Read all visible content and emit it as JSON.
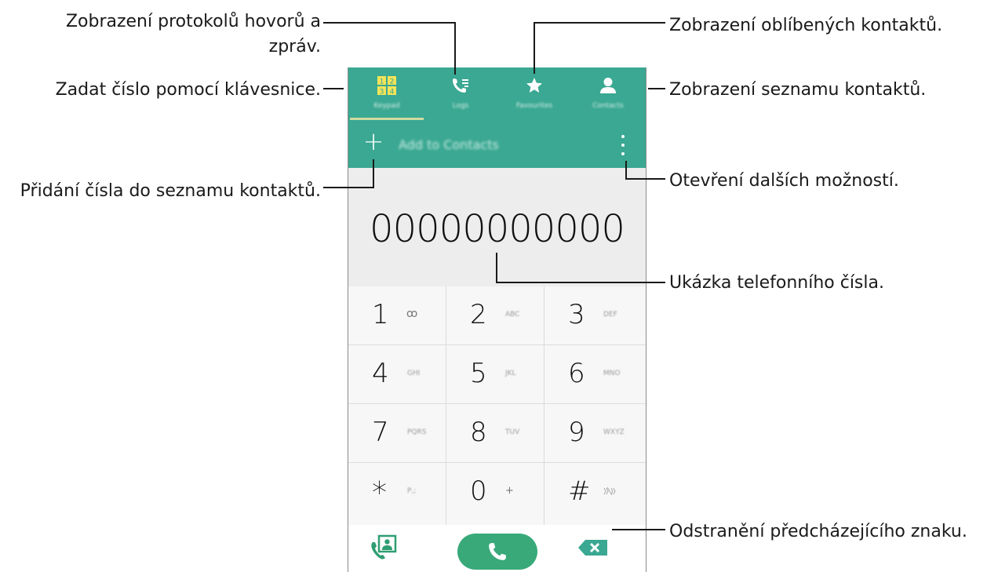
{
  "annotations": {
    "logs": [
      "Zobrazení protokolů hovorů a",
      "zpráv."
    ],
    "keypad": "Zadat číslo pomocí klávesnice.",
    "add_contact": "Přidání čísla do seznamu kontaktů.",
    "favourites": "Zobrazení oblíbených kontaktů.",
    "contacts": "Zobrazení seznamu kontaktů.",
    "more_options": "Otevření dalších možností.",
    "number_preview": "Ukázka telefonního čísla.",
    "delete_char": "Odstranění předcházejícího znaku."
  },
  "phone": {
    "tabs": [
      {
        "label": "Keypad",
        "icon": "keypad-icon"
      },
      {
        "label": "Logs",
        "icon": "call-log-icon"
      },
      {
        "label": "Favourites",
        "icon": "star-icon"
      },
      {
        "label": "Contacts",
        "icon": "person-icon"
      }
    ],
    "action_bar": {
      "plus": "+",
      "add_label": "Add to Contacts",
      "more_icon": "more-vertical-icon"
    },
    "number": "00000000000",
    "keys": [
      {
        "digit": "1",
        "letters": "ꝏ"
      },
      {
        "digit": "2",
        "letters": "ABC"
      },
      {
        "digit": "3",
        "letters": "DEF"
      },
      {
        "digit": "4",
        "letters": "GHI"
      },
      {
        "digit": "5",
        "letters": "JKL"
      },
      {
        "digit": "6",
        "letters": "MNO"
      },
      {
        "digit": "7",
        "letters": "PQRS"
      },
      {
        "digit": "8",
        "letters": "TUV"
      },
      {
        "digit": "9",
        "letters": "WXYZ"
      },
      {
        "digit": "*",
        "letters": "P,;"
      },
      {
        "digit": "0",
        "letters": "+"
      },
      {
        "digit": "#",
        "letters": ""
      }
    ],
    "bottom": {
      "video_call_icon": "video-call-icon",
      "call_icon": "phone-icon",
      "delete_icon": "backspace-icon"
    },
    "colors": {
      "primary": "#3aa892",
      "call": "#39a97a",
      "delete": "#3aa892",
      "display_bg": "#ededed"
    }
  }
}
